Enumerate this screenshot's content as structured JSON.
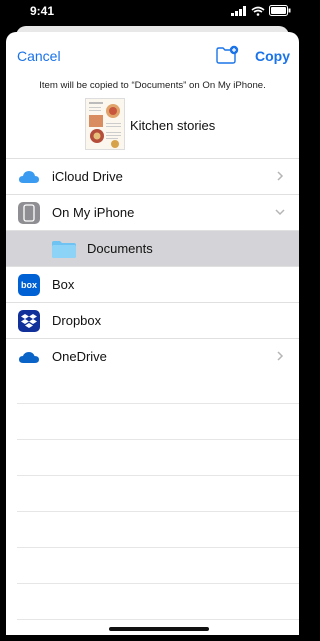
{
  "status": {
    "time": "9:41"
  },
  "nav": {
    "cancel": "Cancel",
    "copy": "Copy"
  },
  "info": "Item will be copied to “Documents” on On My iPhone.",
  "document": {
    "name": "Kitchen stories"
  },
  "locations": [
    {
      "label": "iCloud Drive",
      "icon": "icloud-icon"
    },
    {
      "label": "On My iPhone",
      "icon": "iphone-icon"
    },
    {
      "label": "Documents",
      "icon": "folder-icon"
    },
    {
      "label": "Box",
      "icon": "box-icon"
    },
    {
      "label": "Dropbox",
      "icon": "dropbox-icon"
    },
    {
      "label": "OneDrive",
      "icon": "onedrive-icon"
    }
  ],
  "colors": {
    "accent": "#1a73e8",
    "selected": "#d4d4d8"
  }
}
